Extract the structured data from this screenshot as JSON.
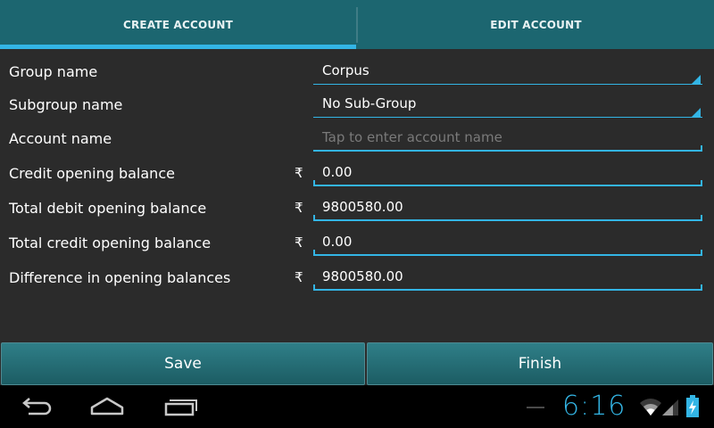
{
  "tabs": [
    {
      "label": "CREATE ACCOUNT",
      "selected": true
    },
    {
      "label": "EDIT ACCOUNT",
      "selected": false
    }
  ],
  "form": {
    "group_name": {
      "label": "Group name",
      "value": "Corpus"
    },
    "subgroup_name": {
      "label": "Subgroup name",
      "value": "No Sub-Group"
    },
    "account_name": {
      "label": "Account name",
      "value": "",
      "placeholder": "Tap to enter account name"
    },
    "credit_opening_balance": {
      "label": "Credit opening balance",
      "currency": "₹",
      "value": "0.00"
    },
    "total_debit_opening_balance": {
      "label": "Total debit opening balance",
      "currency": "₹",
      "value": "9800580.00"
    },
    "total_credit_opening_balance": {
      "label": "Total credit opening balance",
      "currency": "₹",
      "value": "0.00"
    },
    "difference_opening_balances": {
      "label": "Difference in opening balances",
      "currency": "₹",
      "value": "9800580.00"
    }
  },
  "buttons": {
    "save": "Save",
    "finish": "Finish"
  },
  "system_bar": {
    "time": "6:16",
    "icons": [
      "back-icon",
      "home-icon",
      "recent-apps-icon",
      "wifi-icon",
      "signal-icon",
      "battery-charging-icon"
    ]
  },
  "colors": {
    "accent": "#33b5e5",
    "tabbar": "#1c6670",
    "background": "#2b2b2b"
  }
}
